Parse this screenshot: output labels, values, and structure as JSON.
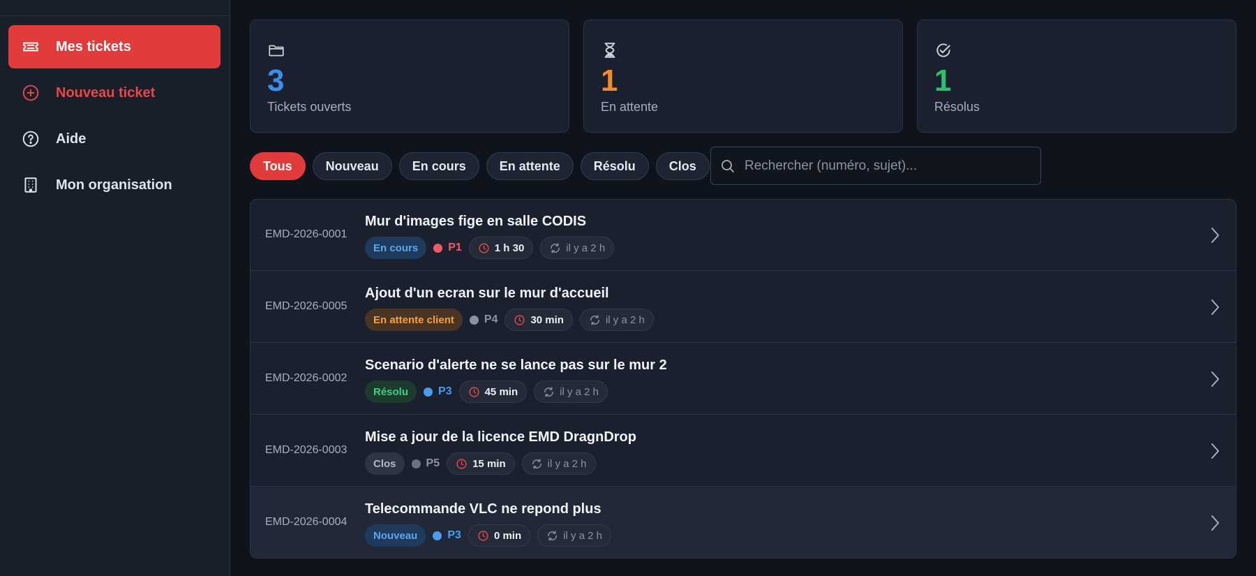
{
  "sidebar": {
    "items": [
      {
        "label": "Mes tickets",
        "icon": "ticket-icon"
      },
      {
        "label": "Nouveau ticket",
        "icon": "plus-circle-icon"
      },
      {
        "label": "Aide",
        "icon": "help-circle-icon"
      },
      {
        "label": "Mon organisation",
        "icon": "building-icon"
      }
    ]
  },
  "stats": [
    {
      "value": "3",
      "label": "Tickets ouverts",
      "icon": "folder-icon",
      "color": "#3b8eea"
    },
    {
      "value": "1",
      "label": "En attente",
      "icon": "hourglass-icon",
      "color": "#f28c2b"
    },
    {
      "value": "1",
      "label": "Résolus",
      "icon": "check-circle-icon",
      "color": "#2fbf71"
    }
  ],
  "filters": {
    "chips": [
      "Tous",
      "Nouveau",
      "En cours",
      "En attente",
      "Résolu",
      "Clos"
    ],
    "active": "Tous"
  },
  "search": {
    "placeholder": "Rechercher (numéro, sujet)...",
    "value": ""
  },
  "tickets": [
    {
      "id": "EMD-2026-0001",
      "subject": "Mur d'images fige en salle CODIS",
      "status": "En cours",
      "status_color": "#5aa8f0",
      "status_bg": "#1f3a5c",
      "priority": "P1",
      "priority_color": "#f05a68",
      "time": "1 h 30",
      "updated": "il y a 2 h"
    },
    {
      "id": "EMD-2026-0005",
      "subject": "Ajout d'un ecran sur le mur d'accueil",
      "status": "En attente client",
      "status_color": "#f5a041",
      "status_bg": "#4a3524",
      "priority": "P4",
      "priority_color": "#8b93a2",
      "time": "30 min",
      "updated": "il y a 2 h"
    },
    {
      "id": "EMD-2026-0002",
      "subject": "Scenario d'alerte ne se lance pas sur le mur 2",
      "status": "Résolu",
      "status_color": "#3fcf7f",
      "status_bg": "#1e3c2e",
      "priority": "P3",
      "priority_color": "#4b9cf0",
      "time": "45 min",
      "updated": "il y a 2 h"
    },
    {
      "id": "EMD-2026-0003",
      "subject": "Mise a jour de la licence EMD DragnDrop",
      "status": "Clos",
      "status_color": "#b3b9c4",
      "status_bg": "#2d3442",
      "priority": "P5",
      "priority_color": "#6b7382",
      "time": "15 min",
      "updated": "il y a 2 h"
    },
    {
      "id": "EMD-2026-0004",
      "subject": "Telecommande VLC ne repond plus",
      "status": "Nouveau",
      "status_color": "#5aa8f0",
      "status_bg": "#1f3a5c",
      "priority": "P3",
      "priority_color": "#4b9cf0",
      "time": "0 min",
      "updated": "il y a 2 h"
    }
  ]
}
